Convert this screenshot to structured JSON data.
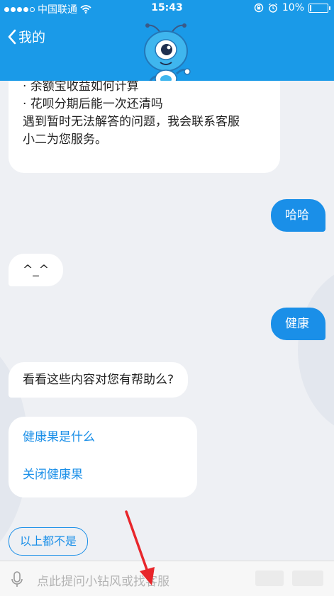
{
  "status": {
    "carrier": "中国联通",
    "time": "15:43",
    "battery": "10%",
    "battery_level": 0.1
  },
  "nav": {
    "back_label": "我的"
  },
  "messages": {
    "first_partial": "· 余额宝收益如何计算",
    "first_line2": "· 花呗分期后能一次还清吗",
    "first_line3": "遇到暂时无法解答的问题，我会联系客服",
    "first_line4": "小二为您服务。",
    "user1": "哈哈",
    "bot1": "^_^",
    "user2": "健康",
    "bot2": "看看这些内容对您有帮助么?",
    "suggest1": "健康果是什么",
    "suggest2": "关闭健康果",
    "none_button": "以上都不是"
  },
  "input": {
    "placeholder": "点此提问小钻风或找客服"
  },
  "colors": {
    "brand_blue": "#1a9ae8",
    "bubble_blue": "#1a8fe8",
    "arrow_red": "#e8262b"
  }
}
